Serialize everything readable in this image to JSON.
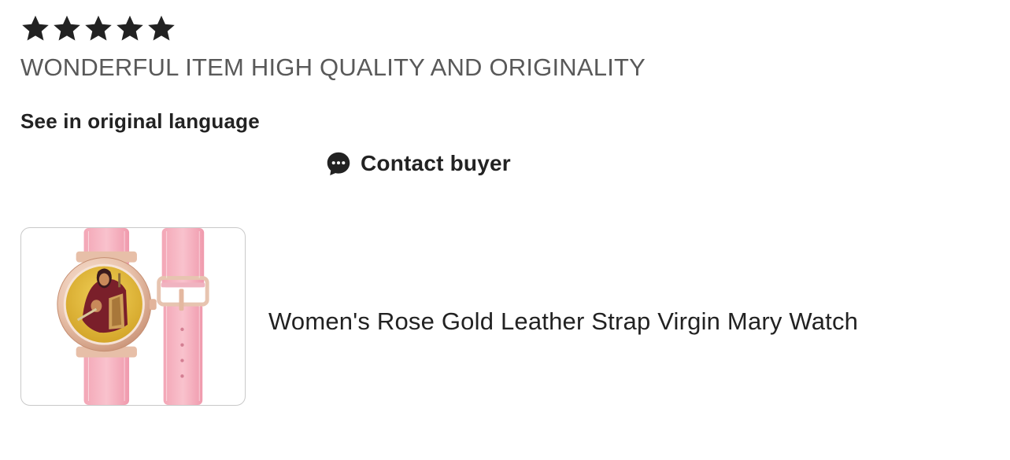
{
  "review": {
    "rating": 5,
    "max_rating": 5,
    "star_color": "#222222",
    "text": "WONDERFUL ITEM HIGH QUALITY AND ORIGINALITY",
    "translate_link": "See in original language"
  },
  "contact": {
    "label": "Contact buyer",
    "icon": "chat-bubble-icon"
  },
  "product": {
    "title": "Women's Rose Gold Leather Strap Virgin Mary Watch",
    "image": "product-thumbnail"
  }
}
